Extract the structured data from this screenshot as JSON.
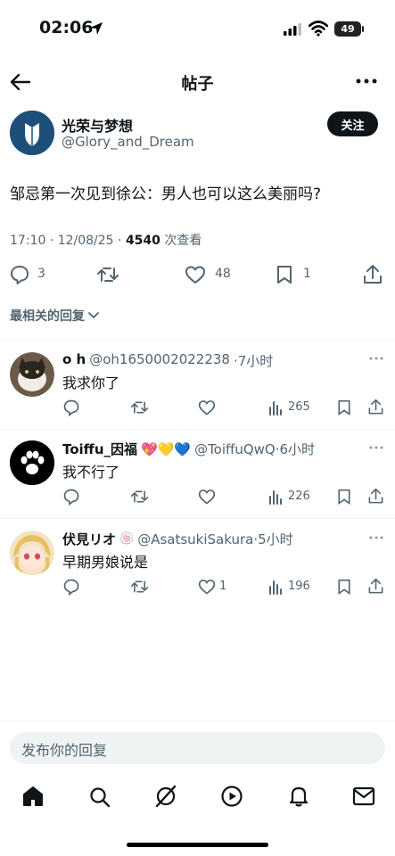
{
  "status_bar": {
    "time": "02:06",
    "battery": "49"
  },
  "header": {
    "title": "帖子"
  },
  "post": {
    "author_name": "光荣与梦想",
    "author_handle": "@Glory_and_Dream",
    "follow_label": "关注",
    "text": "邹忌第一次见到徐公：男人也可以这么美丽吗?",
    "timestamp": "17:10 · 12/08/25 · ",
    "views": "4540",
    "views_label": " 次查看",
    "replies": "3",
    "likes": "48",
    "bookmarks": "1"
  },
  "sort_label": "最相关的回复",
  "replies": [
    {
      "name": "o h",
      "handle": "@oh1650002022238",
      "time": "·7小时",
      "text": "我求你了",
      "views": "265"
    },
    {
      "name": "Toiffu_因福",
      "emojis": "💖💛💙",
      "handle": "@ToiffuQwQ",
      "time": "·6小时",
      "text": "我不行了",
      "views": "226"
    },
    {
      "name": "伏見リオ",
      "badge": "🍥",
      "handle": "@AsatsukiSakura",
      "time": "·5小时",
      "text": "早期男娘说是",
      "likes": "1",
      "views": "196"
    }
  ],
  "composer": {
    "placeholder": "发布你的回复"
  },
  "colors": {
    "text": "#0f1419",
    "secondary": "#536471",
    "divider": "#eff3f4"
  }
}
